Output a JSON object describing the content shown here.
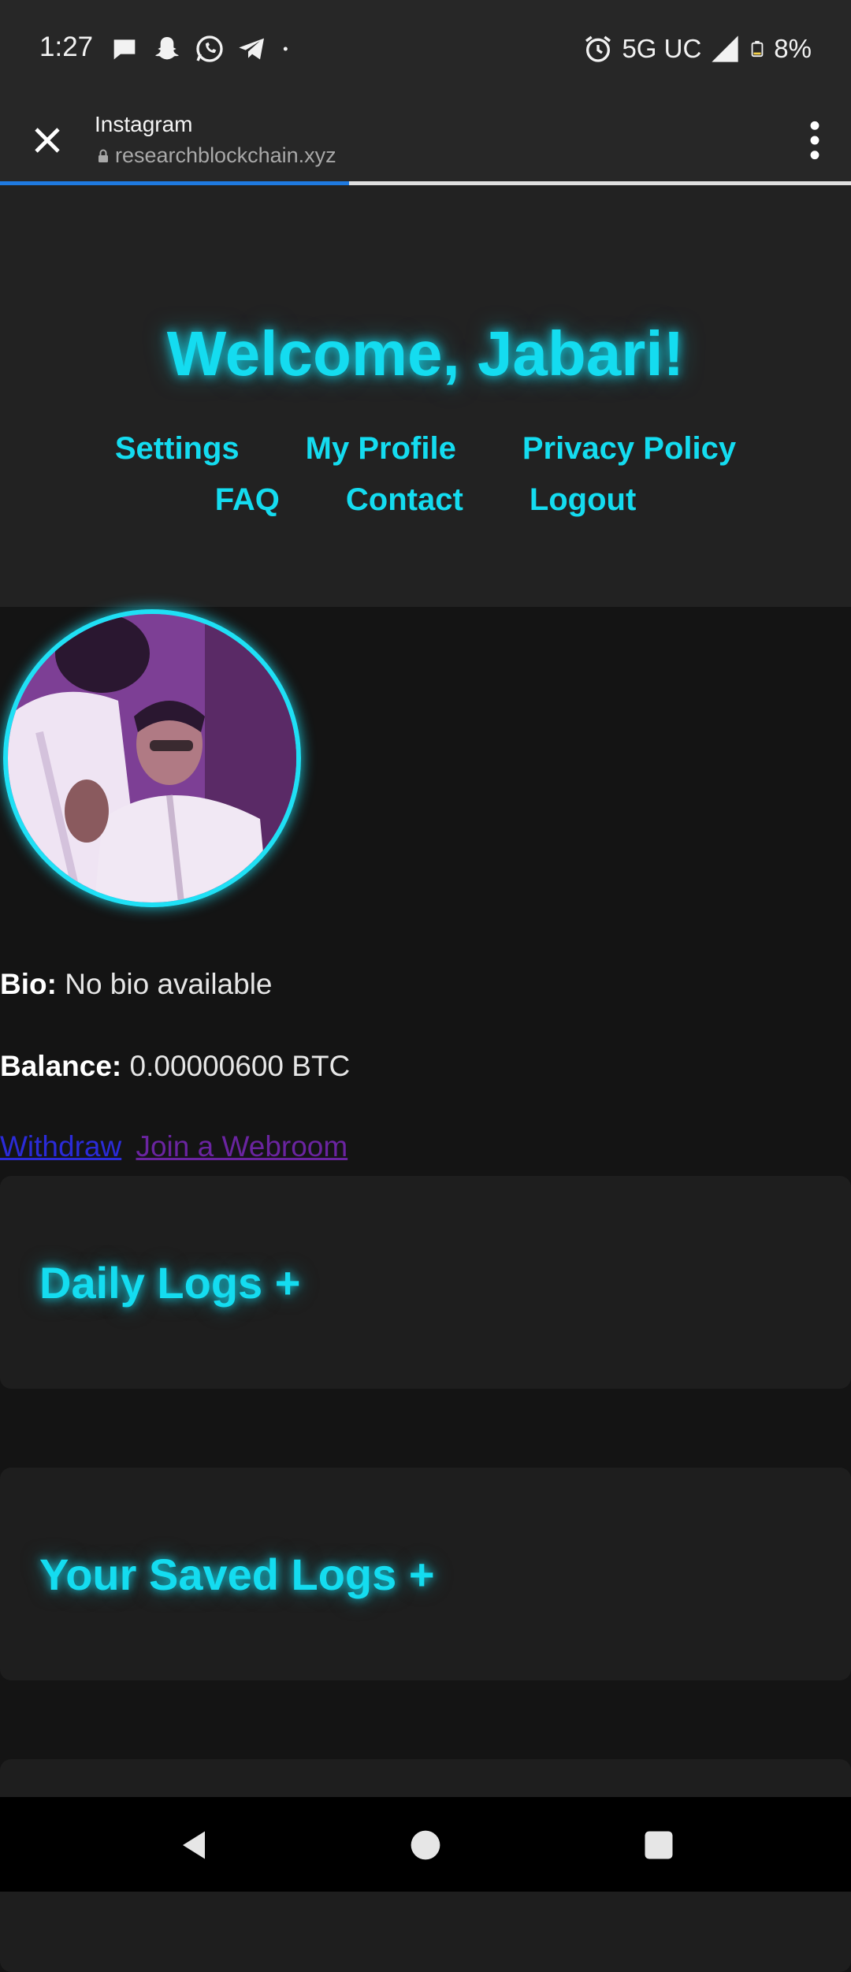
{
  "status_bar": {
    "time": "1:27",
    "network": "5G UC",
    "battery": "8%"
  },
  "browser": {
    "tab_title": "Instagram",
    "url": "researchblockchain.xyz",
    "load_progress": 0.41
  },
  "header": {
    "welcome": "Welcome, Jabari!",
    "nav_row1": [
      "Settings",
      "My Profile",
      "Privacy Policy"
    ],
    "nav_row2": [
      "FAQ",
      "Contact",
      "Logout"
    ]
  },
  "profile": {
    "bio_label": "Bio:",
    "bio_value": "No bio available",
    "balance_label": "Balance:",
    "balance_value": "0.00000600 BTC",
    "withdraw": "Withdraw",
    "join_webroom": "Join a Webroom"
  },
  "sections": {
    "daily_logs": "Daily Logs +",
    "saved_logs": "Your Saved Logs +"
  },
  "colors": {
    "accent": "#14dcf0",
    "link": "#2b2bd8",
    "visited_link": "#6a24a0",
    "background": "#141414"
  }
}
